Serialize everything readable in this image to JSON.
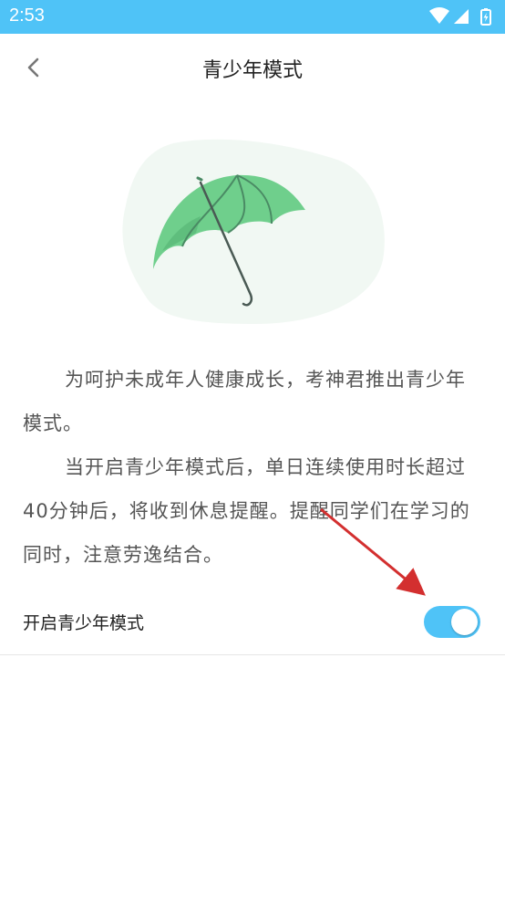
{
  "status_bar": {
    "time": "2:53",
    "icons": [
      "wifi-icon",
      "cell-signal-icon",
      "battery-icon"
    ]
  },
  "header": {
    "title": "青少年模式",
    "back_icon": "chevron-left-icon"
  },
  "illustration": {
    "icon": "umbrella-icon",
    "color": "#6fcf8c"
  },
  "description": {
    "paragraph_1": "为呵护未成年人健康成长，考神君推出青少年模式。",
    "paragraph_2": "当开启青少年模式后，单日连续使用时长超过40分钟后，将收到休息提醒。提醒同学们在学习的同时，注意劳逸结合。"
  },
  "toggle": {
    "label": "开启青少年模式",
    "state": "on",
    "accent_color": "#4fc3f7"
  },
  "annotation": {
    "type": "red-arrow",
    "color": "#d32f2f"
  }
}
